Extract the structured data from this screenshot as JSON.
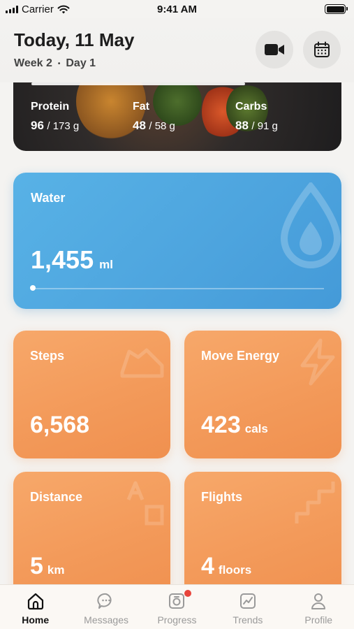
{
  "status_bar": {
    "carrier": "Carrier",
    "time": "9:41 AM"
  },
  "header": {
    "title": "Today, 11 May",
    "week": "Week 2",
    "separator": "•",
    "day": "Day 1",
    "video_icon": "video-camera-icon",
    "calendar_icon": "calendar-icon"
  },
  "macros": {
    "protein": {
      "label": "Protein",
      "value": "96",
      "goal": "/ 173 g"
    },
    "fat": {
      "label": "Fat",
      "value": "48",
      "goal": "/ 58 g"
    },
    "carbs": {
      "label": "Carbs",
      "value": "88",
      "goal": "/ 91 g"
    }
  },
  "water": {
    "title": "Water",
    "value": "1,455",
    "unit": "ml",
    "progress": 0.01,
    "color": "#58b2e6"
  },
  "steps": {
    "title": "Steps",
    "value": "6,568"
  },
  "move_energy": {
    "title": "Move Energy",
    "value": "423",
    "unit": "cals"
  },
  "distance": {
    "title": "Distance",
    "value": "5",
    "unit": "km"
  },
  "flights": {
    "title": "Flights",
    "value": "4",
    "unit": "floors"
  },
  "colors": {
    "accent_orange": "#f39a5a",
    "accent_blue": "#4da4de",
    "badge_red": "#e8453c"
  },
  "tabbar": {
    "items": [
      {
        "label": "Home",
        "icon": "home-icon",
        "active": true
      },
      {
        "label": "Messages",
        "icon": "chat-bubble-icon",
        "active": false
      },
      {
        "label": "Progress",
        "icon": "camera-icon",
        "active": false,
        "badge": true
      },
      {
        "label": "Trends",
        "icon": "trend-chart-icon",
        "active": false
      },
      {
        "label": "Profile",
        "icon": "user-icon",
        "active": false
      }
    ]
  }
}
